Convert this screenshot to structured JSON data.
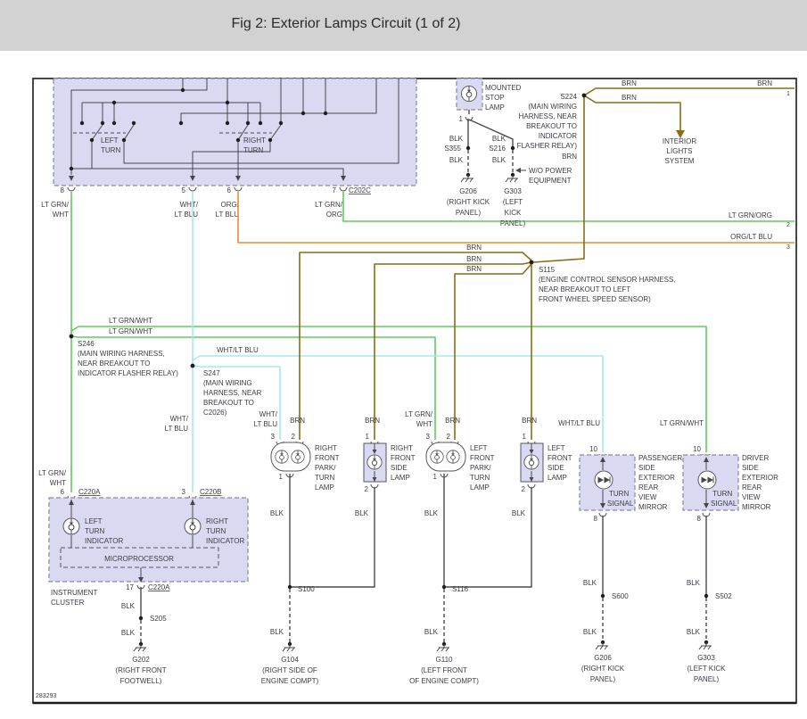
{
  "header": {
    "title": "Fig 2: Exterior Lamps Circuit (1 of 2)"
  },
  "doc_number": "283293",
  "colors": {
    "header_bar": "#d2d2d2",
    "box_fill": "#d9daf2",
    "wire_green": "#5ccf5c",
    "wire_cyan": "#a5e8ee",
    "wire_orange": "#e0912f",
    "wire_brown": "#8a6d15",
    "wire_black": "#4b4b4b"
  },
  "wire": {
    "blk": "BLK",
    "brn": "BRN"
  },
  "switch_box": {
    "left_turn": [
      "LEFT",
      "TURN"
    ],
    "right_turn": [
      "RIGHT",
      "TURN"
    ],
    "connector": "C202C",
    "pins": {
      "p8": "8",
      "p5": "5",
      "p6": "6",
      "p7": "7"
    },
    "wires": {
      "p8": [
        "LT GRN/",
        "WHT"
      ],
      "p5": [
        "WHT/",
        "LT BLU"
      ],
      "p6": [
        "ORG/",
        "LT BLU"
      ],
      "p7": [
        "LT GRN/",
        "ORG"
      ]
    }
  },
  "stop_lamp": {
    "name": [
      "MOUNTED",
      "STOP",
      "LAMP"
    ],
    "pin": "1",
    "s355": "S355",
    "s216": "S216",
    "wo_power": [
      "W/O POWER",
      "EQUIPMENT"
    ],
    "g206": [
      "G206",
      "(RIGHT KICK",
      "PANEL)"
    ],
    "g303": [
      "G303",
      "(LEFT",
      "KICK",
      "PANEL)"
    ]
  },
  "s224": {
    "label": "S224",
    "desc": [
      "(MAIN WIRING",
      "HARNESS, NEAR",
      "BREAKOUT TO",
      "INDICATOR",
      "FLASHER RELAY)"
    ]
  },
  "interior_lights": [
    "INTERIOR",
    "LIGHTS",
    "SYSTEM"
  ],
  "edge": {
    "n1": "1",
    "n2": "2",
    "n3": "3",
    "lt_grn_org": "LT GRN/ORG",
    "org_lt_blu": "ORG/LT BLU"
  },
  "s115": {
    "label": "S115",
    "desc": [
      "(ENGINE CONTROL SENSOR HARNESS,",
      "NEAR BREAKOUT TO LEFT",
      "FRONT WHEEL SPEED SENSOR)"
    ]
  },
  "s246": {
    "label": "S246",
    "desc": [
      "(MAIN WIRING HARNESS,",
      "NEAR BREAKOUT TO",
      "INDICATOR FLASHER RELAY)"
    ],
    "wire": "LT GRN/WHT"
  },
  "s247": {
    "label": "S247",
    "desc": [
      "(MAIN WIRING",
      "HARNESS, NEAR",
      "BREAKOUT TO",
      "C2026)"
    ],
    "wire": "WHT/LT BLU"
  },
  "lamps": {
    "rf_pt": {
      "name": [
        "RIGHT",
        "FRONT",
        "PARK/",
        "TURN",
        "LAMP"
      ],
      "p3": "3",
      "p2": "2",
      "p1": "1",
      "w3": [
        "WHT/",
        "LT BLU"
      ]
    },
    "rf_side": {
      "name": [
        "RIGHT",
        "FRONT",
        "SIDE",
        "LAMP"
      ],
      "p1": "1",
      "p2": "2"
    },
    "lf_pt": {
      "name": [
        "LEFT",
        "FRONT",
        "PARK/",
        "TURN",
        "LAMP"
      ],
      "p3": "3",
      "p2": "2",
      "p1": "1",
      "w3": [
        "LT GRN/",
        "WHT"
      ]
    },
    "lf_side": {
      "name": [
        "LEFT",
        "FRONT",
        "SIDE",
        "LAMP"
      ],
      "p1": "1",
      "p2": "2"
    }
  },
  "mirrors": {
    "passenger": {
      "name": [
        "PASSENGER",
        "SIDE",
        "EXTERIOR",
        "REAR",
        "VIEW",
        "MIRROR"
      ],
      "inner": [
        "TURN",
        "SIGNAL"
      ],
      "p10": "10",
      "p8": "8",
      "wire": "WHT/LT BLU",
      "splice": "S600",
      "ground": [
        "G206",
        "(RIGHT KICK",
        "PANEL)"
      ]
    },
    "driver": {
      "name": [
        "DRIVER",
        "SIDE",
        "EXTERIOR",
        "REAR",
        "VIEW",
        "MIRROR"
      ],
      "inner": [
        "TURN",
        "SIGNAL"
      ],
      "p10": "10",
      "p8": "8",
      "wire": "LT GRN/WHT",
      "splice": "S502",
      "ground": [
        "G303",
        "(LEFT KICK",
        "PANEL)"
      ]
    }
  },
  "cluster": {
    "name": [
      "INSTRUMENT",
      "CLUSTER"
    ],
    "p6": "6",
    "c220a": "C220A",
    "p3": "3",
    "c220b": "C220B",
    "p17": "17",
    "c220a2": "C220A",
    "left_ind": [
      "LEFT",
      "TURN",
      "INDICATOR"
    ],
    "right_ind": [
      "RIGHT",
      "TURN",
      "INDICATOR"
    ],
    "micro": "MICROPROCESSOR",
    "w6": [
      "LT GRN/",
      "WHT"
    ],
    "w3": [
      "WHT/",
      "LT BLU"
    ],
    "s205": "S205",
    "ground": [
      "G202",
      "(RIGHT FRONT",
      "FOOTWELL)"
    ]
  },
  "splices": {
    "s100": "S100",
    "s116": "S116"
  },
  "grounds": {
    "g104": [
      "G104",
      "(RIGHT SIDE OF",
      "ENGINE COMPT)"
    ],
    "g110": [
      "G110",
      "(LEFT FRONT",
      "OF ENGINE COMPT)"
    ]
  }
}
